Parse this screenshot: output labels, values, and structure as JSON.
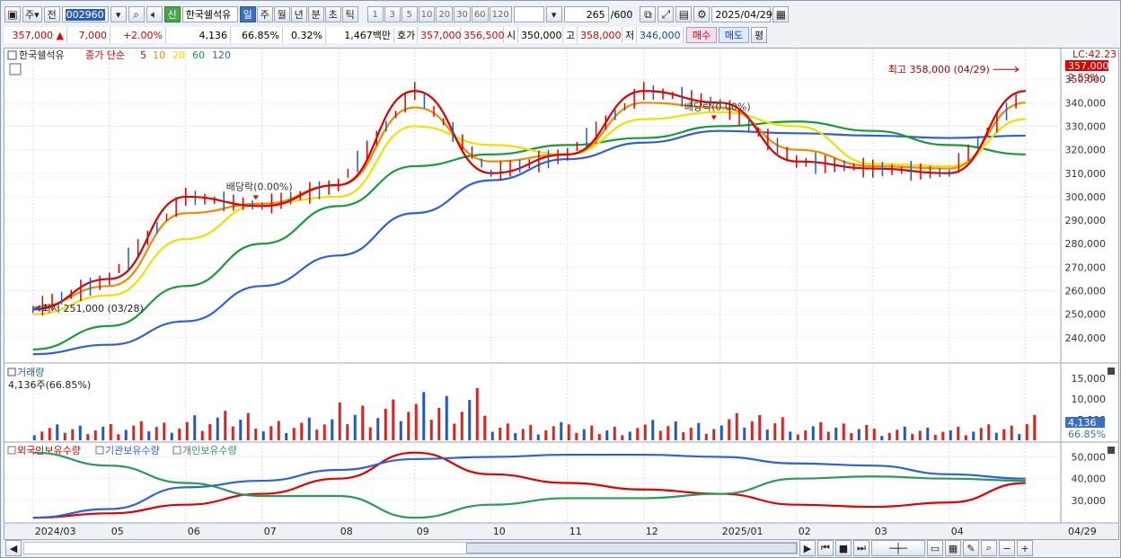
{
  "toolbar": {
    "type_label": "주",
    "prev_label": "전",
    "code": "002960",
    "new_badge": "신",
    "stock_name": "한국쉘석유",
    "periods": [
      "일",
      "주",
      "월",
      "년",
      "분",
      "초",
      "틱"
    ],
    "selected_period": "일",
    "intervals": [
      "1",
      "3",
      "5",
      "10",
      "20",
      "30",
      "60",
      "120"
    ],
    "count": "265",
    "count_total": "/600",
    "date": "2025/04/29"
  },
  "quote": {
    "price": "357,000",
    "change_arrow": "▲",
    "change": "7,000",
    "change_pct": "+2.00%",
    "volume": "4,136",
    "volume_ratio": "66.85%",
    "turnover": "0.32%",
    "amount": "1,467백만",
    "ask_label": "호가",
    "ask1": "357,000",
    "ask2": "356,500",
    "open_label": "시",
    "open": "350,000",
    "high_label": "고",
    "high": "358,000",
    "low_label": "저",
    "low": "346,000",
    "buy_label": "매수",
    "sell_label": "매도",
    "eval_label": "평"
  },
  "chart_data": [
    {
      "type": "line",
      "name": "price",
      "header_name": "한국쉘석유",
      "legend": [
        {
          "name": "종가 단순",
          "color": "#dd0000"
        },
        {
          "name": "5",
          "color": "#dd0000"
        },
        {
          "name": "10",
          "color": "#f08a00"
        },
        {
          "name": "20",
          "color": "#f0e000"
        },
        {
          "name": "60",
          "color": "#1a9a3a"
        },
        {
          "name": "120",
          "color": "#3060d8"
        }
      ],
      "lc_label": "LC:42.23",
      "last_price_label": "357,000",
      "change_label": "2.59%",
      "annotations": [
        {
          "text": "최고 358,000 (04/29)",
          "x": "2025-04-29",
          "y": 358000
        },
        {
          "text": "최저 251,000 (03/28)",
          "x": "2024-03-28",
          "y": 251000
        },
        {
          "text": "배당락(0.00%)",
          "x": "2024-06-27",
          "y": 296000
        },
        {
          "text": "배당락(0.00%)",
          "x": "2024-12-27",
          "y": 330000
        }
      ],
      "ylim": [
        230000,
        360000
      ],
      "yticks": [
        240000,
        250000,
        260000,
        270000,
        280000,
        290000,
        300000,
        310000,
        320000,
        330000,
        340000,
        350000
      ],
      "ytick_labels": [
        "240,000",
        "250,000",
        "260,000",
        "270,000",
        "280,000",
        "290,000",
        "300,000",
        "310,000",
        "320,000",
        "330,000",
        "340,000",
        "350,000"
      ],
      "x": [
        "2024-03",
        "2024-04",
        "2024-05",
        "2024-06",
        "2024-07",
        "2024-08",
        "2024-09",
        "2024-10",
        "2024-11",
        "2024-12",
        "2025-01",
        "2025-02",
        "2025-03",
        "2025-04"
      ],
      "series": [
        {
          "name": "5",
          "color": "#dd0000",
          "values": [
            252000,
            265000,
            300000,
            296000,
            305000,
            345000,
            310000,
            318000,
            345000,
            340000,
            315000,
            312000,
            310000,
            345000
          ]
        },
        {
          "name": "10",
          "color": "#f08a00",
          "values": [
            253000,
            262000,
            293000,
            297000,
            305000,
            338000,
            315000,
            318000,
            340000,
            338000,
            320000,
            313000,
            312000,
            340000
          ]
        },
        {
          "name": "20",
          "color": "#f0e000",
          "values": [
            250000,
            258000,
            282000,
            297000,
            300000,
            330000,
            322000,
            318000,
            333000,
            336000,
            330000,
            314000,
            313000,
            333000
          ]
        },
        {
          "name": "60",
          "color": "#1a9a3a",
          "values": [
            235000,
            245000,
            262000,
            280000,
            296000,
            313000,
            318000,
            322000,
            325000,
            330000,
            332000,
            328000,
            322000,
            318000
          ]
        },
        {
          "name": "120",
          "color": "#3060d8",
          "values": [
            233000,
            237000,
            247000,
            262000,
            275000,
            293000,
            307000,
            316000,
            323000,
            328000,
            327000,
            326000,
            325000,
            326000
          ]
        }
      ]
    },
    {
      "type": "bar",
      "name": "volume",
      "title": "거래량",
      "current_label": "4,136주(66.85%)",
      "badge_value": "4,136",
      "badge_pct": "66.85%",
      "yticks": [
        5000,
        10000,
        15000
      ],
      "ytick_labels": [
        "5,000",
        "10,000",
        "15,000"
      ],
      "ylim": [
        0,
        17000
      ],
      "categories": [
        "2024-03",
        "2024-04",
        "2024-05",
        "2024-06",
        "2024-07",
        "2024-08",
        "2024-09",
        "2024-10",
        "2024-11",
        "2024-12",
        "2025-01",
        "2025-02",
        "2025-03",
        "2025-04"
      ],
      "values": [
        3500,
        4200,
        6500,
        5000,
        9000,
        11500,
        4000,
        3500,
        4500,
        6000,
        4000,
        3000,
        3500,
        9000
      ]
    },
    {
      "type": "line",
      "name": "holdings",
      "legend": [
        {
          "name": "외국인보유수량",
          "color": "#dd0000"
        },
        {
          "name": "기관보유수량",
          "color": "#3060d8"
        },
        {
          "name": "개인보유수량",
          "color": "#2a9a5a"
        }
      ],
      "ylim": [
        20000,
        56000
      ],
      "yticks": [
        30000,
        40000,
        50000
      ],
      "ytick_labels": [
        "30,000",
        "40,000",
        "50,000"
      ],
      "x": [
        "2024-03",
        "2024-04",
        "2024-05",
        "2024-06",
        "2024-07",
        "2024-08",
        "2024-09",
        "2024-10",
        "2024-11",
        "2024-12",
        "2025-01",
        "2025-02",
        "2025-03",
        "2025-04"
      ],
      "series": [
        {
          "name": "외국인보유수량",
          "color": "#dd0000",
          "values": [
            22000,
            24000,
            28000,
            33000,
            40000,
            52000,
            42000,
            38000,
            35000,
            33000,
            28000,
            27000,
            29000,
            38000
          ]
        },
        {
          "name": "기관보유수량",
          "color": "#3060d8",
          "values": [
            22000,
            26000,
            36000,
            39000,
            44000,
            49000,
            50000,
            51000,
            51000,
            50000,
            47000,
            46000,
            42000,
            40000
          ]
        },
        {
          "name": "개인보유수량",
          "color": "#2a9a5a",
          "values": [
            52000,
            46000,
            38000,
            32000,
            32000,
            22000,
            28000,
            31000,
            31000,
            33000,
            40000,
            41000,
            40000,
            39000
          ]
        }
      ]
    }
  ],
  "xaxis": {
    "labels": [
      "2024/03",
      "05",
      "06",
      "07",
      "08",
      "09",
      "10",
      "11",
      "12",
      "2025/01",
      "02",
      "03",
      "04",
      "04/29"
    ]
  }
}
